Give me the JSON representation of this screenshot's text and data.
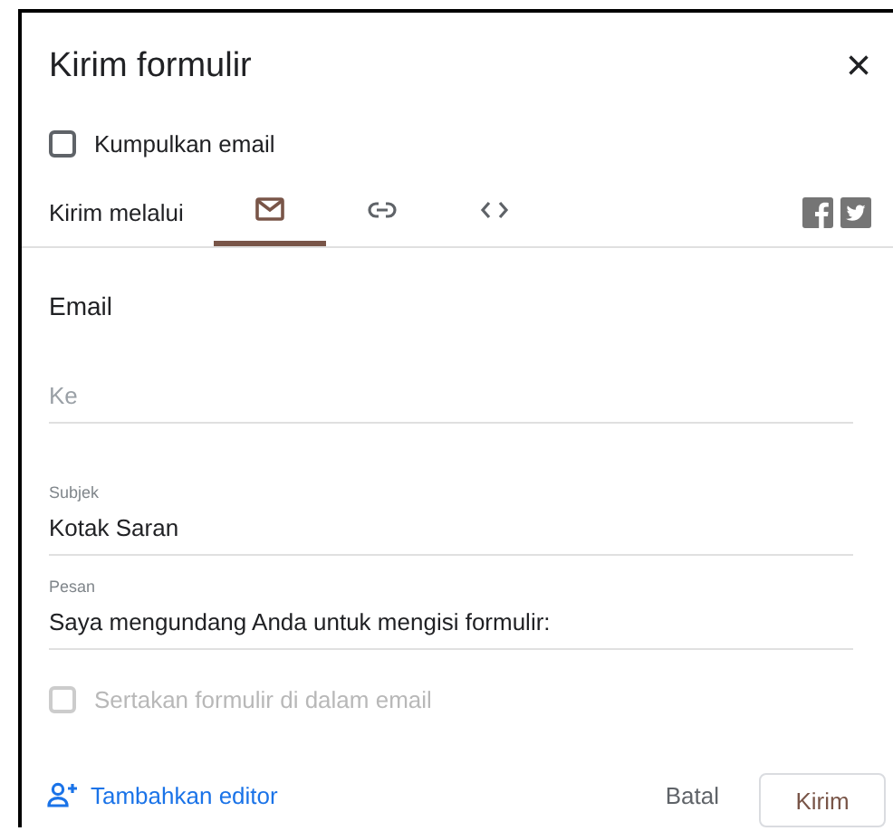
{
  "dialog": {
    "title": "Kirim formulir",
    "close": "×"
  },
  "collect_email": {
    "label": "Kumpulkan email",
    "checked": false
  },
  "send_via": {
    "label": "Kirim melalui",
    "tabs": [
      {
        "kind": "email",
        "selected": true
      },
      {
        "kind": "link",
        "selected": false
      },
      {
        "kind": "embed",
        "selected": false
      }
    ],
    "share": [
      {
        "kind": "facebook"
      },
      {
        "kind": "twitter"
      }
    ]
  },
  "section_title": "Email",
  "fields": [
    {
      "placeholder": "Ke"
    },
    {
      "label": "Subjek",
      "value": "Kotak Saran"
    },
    {
      "label": "Pesan",
      "value": "Saya mengundang Anda untuk mengisi formulir:"
    }
  ],
  "include_form": {
    "label": "Sertakan formulir di dalam email",
    "checked": false,
    "disabled": true
  },
  "footer": {
    "add_editor": "Tambahkan editor",
    "cancel": "Batal",
    "send": "Kirim"
  }
}
